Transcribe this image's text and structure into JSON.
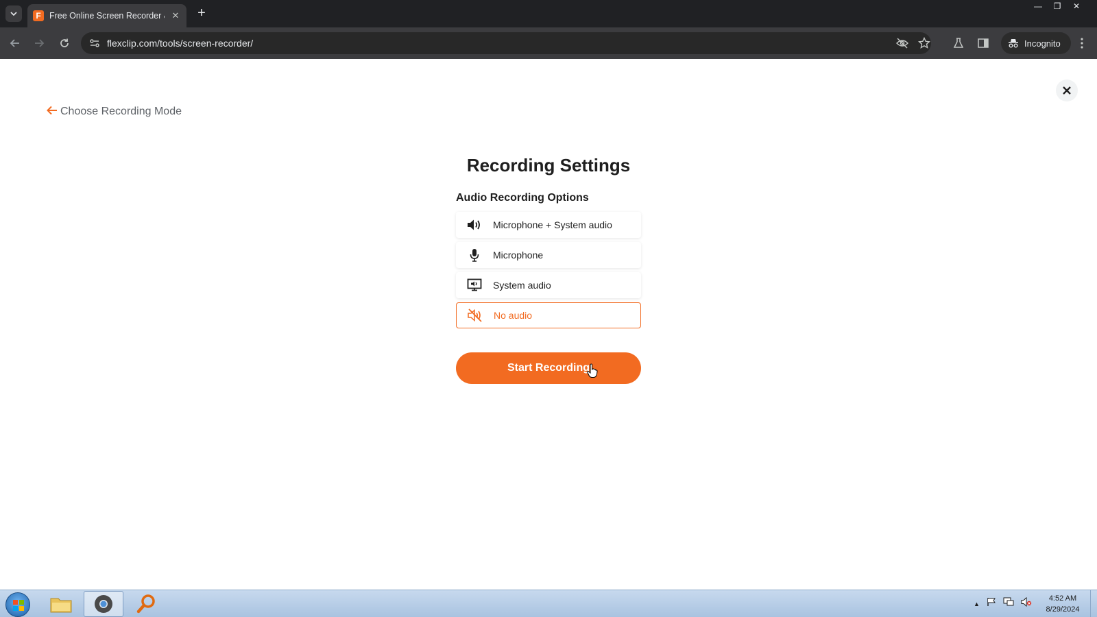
{
  "browser": {
    "tab_title": "Free Online Screen Recorder &",
    "favicon_letter": "F",
    "url": "flexclip.com/tools/screen-recorder/",
    "incognito_label": "Incognito"
  },
  "page": {
    "back_label": "Choose Recording Mode",
    "title": "Recording Settings",
    "section_title": "Audio Recording Options",
    "options": [
      {
        "label": "Microphone + System audio",
        "icon": "speaker-icon",
        "selected": false
      },
      {
        "label": "Microphone",
        "icon": "microphone-icon",
        "selected": false
      },
      {
        "label": "System audio",
        "icon": "monitor-audio-icon",
        "selected": false
      },
      {
        "label": "No audio",
        "icon": "muted-icon",
        "selected": true
      }
    ],
    "start_button_label": "Start Recording",
    "accent_color": "#f26b21"
  },
  "taskbar": {
    "time": "4:52 AM",
    "date": "8/29/2024"
  }
}
